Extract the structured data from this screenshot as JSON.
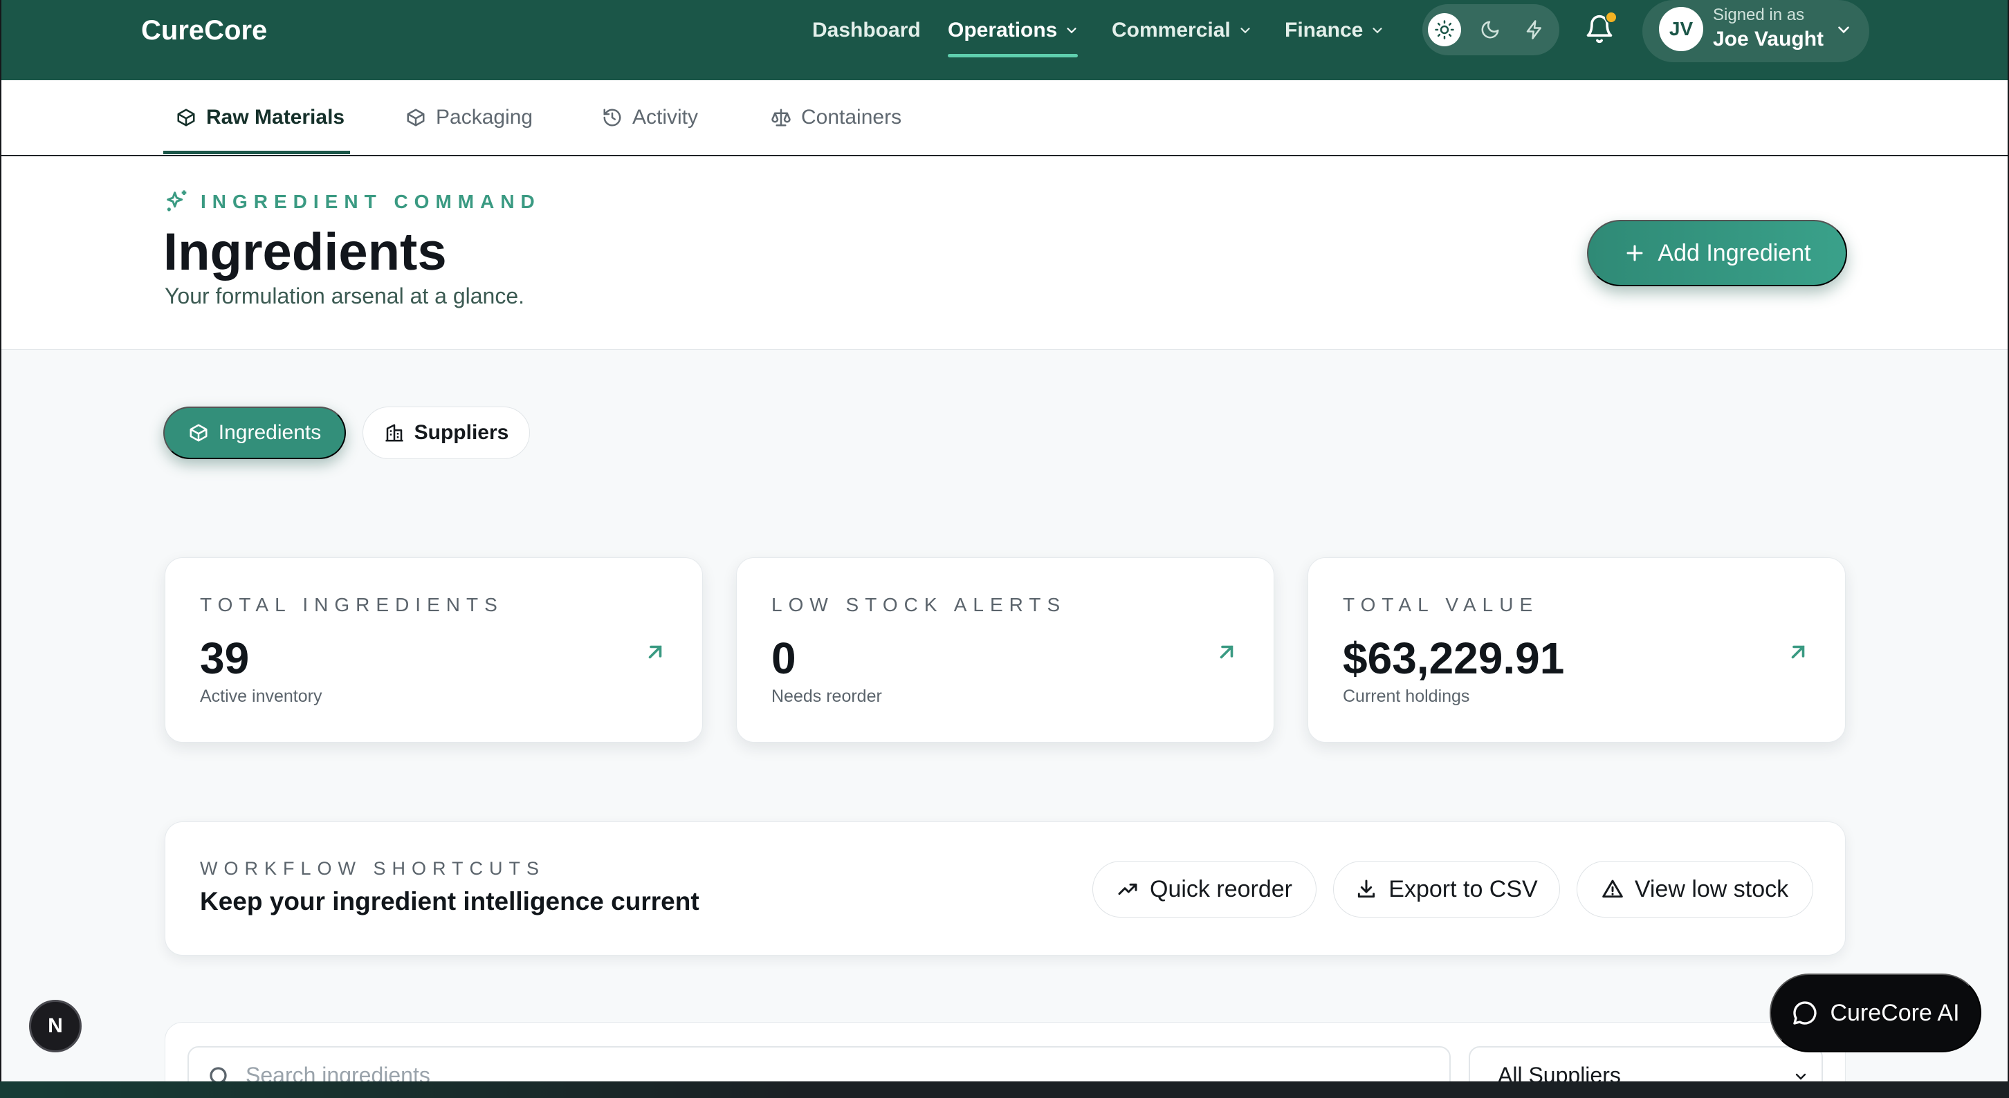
{
  "app": {
    "brand": "CureCore"
  },
  "topnav": {
    "items": [
      {
        "label": "Dashboard"
      },
      {
        "label": "Operations"
      },
      {
        "label": "Commercial"
      },
      {
        "label": "Finance"
      }
    ],
    "active": "Operations",
    "theme_modes": [
      "sun-icon",
      "moon-icon",
      "bolt-icon"
    ],
    "notifications_badge": true
  },
  "user": {
    "initials": "JV",
    "signed_in_label": "Signed in as",
    "name": "Joe Vaught"
  },
  "subtabs": {
    "items": [
      {
        "label": "Raw Materials",
        "icon": "box-icon"
      },
      {
        "label": "Packaging",
        "icon": "box-icon"
      },
      {
        "label": "Activity",
        "icon": "history-icon"
      },
      {
        "label": "Containers",
        "icon": "scale-icon"
      }
    ],
    "active": "Raw Materials"
  },
  "header": {
    "eyebrow": "INGREDIENT COMMAND",
    "title": "Ingredients",
    "subtitle": "Your formulation arsenal at a glance.",
    "add_button": "Add Ingredient"
  },
  "segments": [
    {
      "label": "Ingredients",
      "icon": "box-icon",
      "active": true
    },
    {
      "label": "Suppliers",
      "icon": "building-icon",
      "active": false
    }
  ],
  "stats": [
    {
      "label": "TOTAL INGREDIENTS",
      "value": "39",
      "sub": "Active inventory"
    },
    {
      "label": "LOW STOCK ALERTS",
      "value": "0",
      "sub": "Needs reorder"
    },
    {
      "label": "TOTAL VALUE",
      "value": "$63,229.91",
      "sub": "Current holdings"
    }
  ],
  "shortcuts": {
    "label": "WORKFLOW SHORTCUTS",
    "title": "Keep your ingredient intelligence current",
    "buttons": [
      {
        "label": "Quick reorder",
        "icon": "trend-up-icon"
      },
      {
        "label": "Export to CSV",
        "icon": "download-icon"
      },
      {
        "label": "View low stock",
        "icon": "warning-icon"
      }
    ]
  },
  "filters": {
    "search_placeholder": "Search ingredients",
    "supplier_select": "All Suppliers"
  },
  "floating": {
    "dev_badge": "N",
    "ai_button": "CureCore AI"
  },
  "colors": {
    "primary": "#1b5648",
    "accent": "#3aa18a",
    "notify": "#f4b323"
  }
}
